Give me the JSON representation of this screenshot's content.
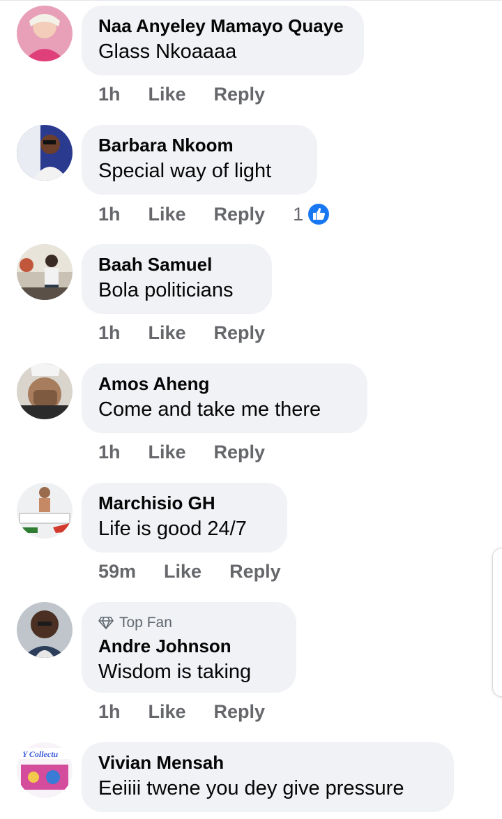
{
  "comments": [
    {
      "name": "Naa Anyeley Mamayo Quaye",
      "text": "Glass Nkoaaaa",
      "time": "1h",
      "like": "Like",
      "reply": "Reply"
    },
    {
      "name": "Barbara Nkoom",
      "text": "Special way of light",
      "time": "1h",
      "like": "Like",
      "reply": "Reply",
      "reactions": "1"
    },
    {
      "name": "Baah Samuel",
      "text": "Bola politicians",
      "time": "1h",
      "like": "Like",
      "reply": "Reply"
    },
    {
      "name": "Amos Aheng",
      "text": "Come and take me there",
      "time": "1h",
      "like": "Like",
      "reply": "Reply"
    },
    {
      "name": "Marchisio GH",
      "text": "Life is good 24/7",
      "time": "59m",
      "like": "Like",
      "reply": "Reply"
    },
    {
      "badge": "Top Fan",
      "name": "Andre Johnson",
      "text": "Wisdom is taking",
      "time": "1h",
      "like": "Like",
      "reply": "Reply"
    },
    {
      "name": "Vivian Mensah",
      "text": "Eeiiii twene you dey give pressure",
      "avatar_text": "Y Collectu"
    }
  ],
  "colors": {
    "like_blue": "#1877f2",
    "bubble_bg": "#f0f2f5",
    "meta_gray": "#65676b"
  }
}
